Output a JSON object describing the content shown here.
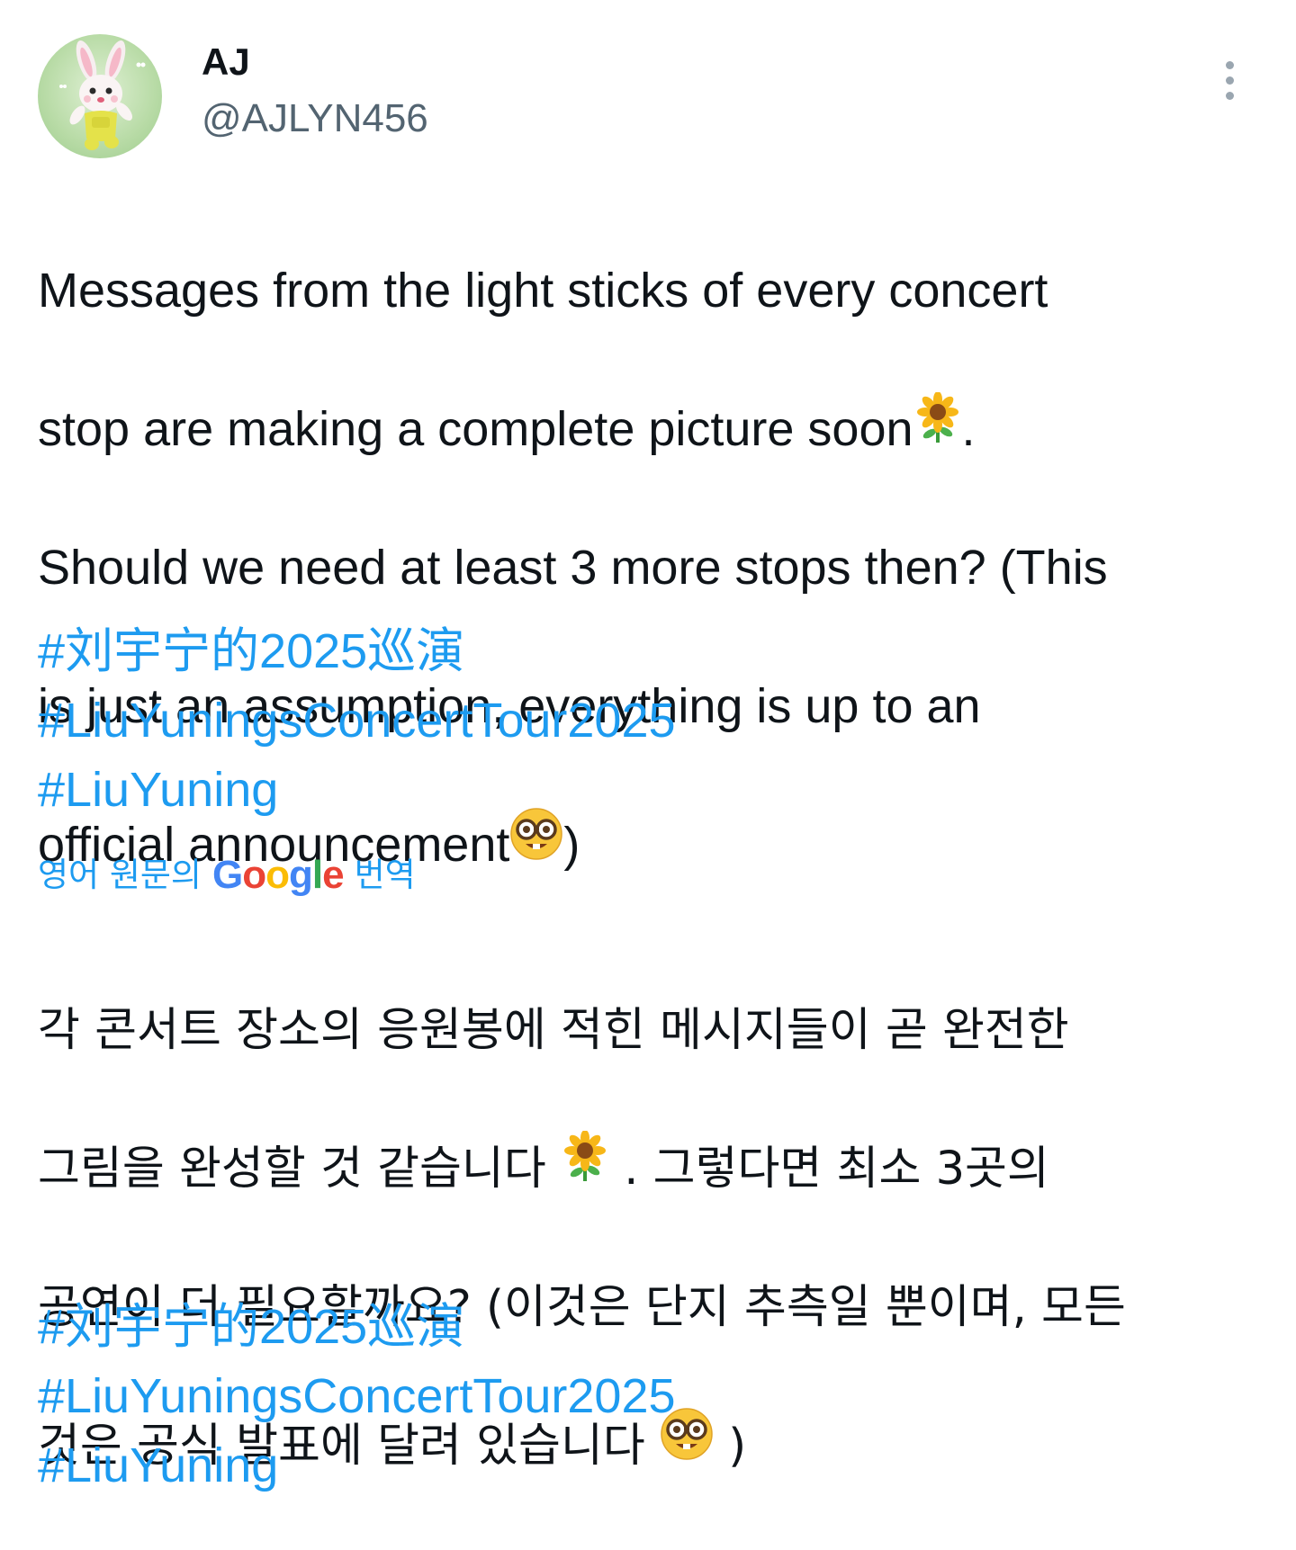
{
  "tweet": {
    "author": {
      "display_name": "AJ",
      "handle": "@AJLYN456",
      "avatar_icon": "bunny-avatar-icon"
    },
    "more_icon": "more-vertical-icon",
    "original_text": {
      "line1": "Messages from the light sticks of every concert",
      "line2a": "stop are making a complete picture soon",
      "line2b": ".",
      "line3": "Should we need at least 3 more stops then? (This",
      "line4": "is just an assumption, everything is up to an",
      "line5a": "official announcement",
      "line5b": ")"
    },
    "hashtags": [
      "#刘宇宁的2025巡演",
      "#LiuYuningsConcertTour2025",
      "#LiuYuning"
    ],
    "translation_note": {
      "prefix": "영어 원문의",
      "brand": "Google",
      "suffix": "번역"
    },
    "translated_text": {
      "line1": "각 콘서트 장소의 응원봉에 적힌 메시지들이 곧 완전한",
      "line2a": "그림을 완성할 것 같습니다",
      "line2b": ". 그렇다면 최소 3곳의",
      "line3": "공연이 더 필요할까요? (이것은 단지 추측일 뿐이며, 모든",
      "line4a": "것은 공식 발표에 달려 있습니다",
      "line4b": ")"
    },
    "translated_hashtags": [
      "#刘宇宁的2025巡演",
      "#LiuYuningsConcertTour2025",
      "#LiuYuning"
    ],
    "emoji_icons": [
      "sunflower-icon",
      "nerd-face-icon"
    ],
    "colors": {
      "link": "#1d9bf0",
      "text": "#0f1419",
      "secondary": "#536471"
    }
  }
}
